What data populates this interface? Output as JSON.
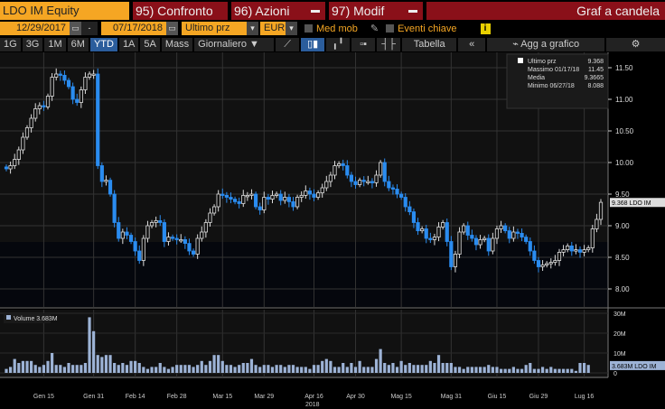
{
  "header": {
    "ticker": "LDO IM Equity",
    "compare": "95) Confronto",
    "actions": "96) Azioni",
    "modify": "97) Modif",
    "chart_type": "Graf a candela"
  },
  "controls": {
    "start_date": "12/29/2017",
    "sep": "-",
    "end_date": "07/17/2018",
    "field": "Ultimo prz",
    "currency": "EUR",
    "moving_avg": "Med mob",
    "key_events": "Eventi chiave",
    "info": "i"
  },
  "toolbar": {
    "periods": [
      "1G",
      "3G",
      "1M",
      "6M",
      "YTD",
      "1A",
      "5A",
      "Mass"
    ],
    "active_period": "YTD",
    "frequency": "Giornaliero ▼",
    "table": "Tabella",
    "collapse": "«",
    "add_to_chart": "Agg a grafico",
    "settings": "⚙"
  },
  "colors": {
    "up": "#dddddd",
    "down": "#2a8cf0",
    "volume": "#9db3d6",
    "accent": "#f5a623",
    "header_red": "#8a1019"
  },
  "chart_data": {
    "type": "candlestick",
    "legend": {
      "last_label": "Ultimo prz",
      "last": "9.368",
      "high_label": "Massimo 01/17/18",
      "high": "11.45",
      "mean_label": "Media",
      "mean": "9.3665",
      "low_label": "Minimo 06/27/18",
      "low": "8.088"
    },
    "price_ticks": [
      "11.50",
      "11.00",
      "10.50",
      "10.00",
      "9.50",
      "9.00",
      "8.50",
      "8.00"
    ],
    "ylim": [
      7.7,
      11.8
    ],
    "last_tag": "9.368 LDO IM",
    "volume_label": "Volume 3.683M",
    "volume_ticks": [
      "30M",
      "20M",
      "10M",
      "0"
    ],
    "volume_tag": "3.683M LDO IM",
    "x_ticks": [
      "Gen 15",
      "Gen 31",
      "Feb 14",
      "Feb 28",
      "Mar 15",
      "Mar 29",
      "Apr 16",
      "Apr 30",
      "Mag 15",
      "Mag 31",
      "Giu 15",
      "Giu 29",
      "Lug 16"
    ],
    "x_tick_index": [
      9,
      21,
      31,
      41,
      52,
      62,
      74,
      84,
      95,
      107,
      118,
      128,
      139
    ],
    "year": "2018",
    "closes": [
      9.9,
      9.95,
      10.05,
      10.2,
      10.4,
      10.55,
      10.7,
      10.85,
      10.9,
      10.88,
      11.05,
      11.35,
      11.4,
      11.38,
      11.3,
      11.2,
      11.0,
      10.95,
      11.15,
      11.35,
      11.4,
      11.4,
      9.95,
      9.7,
      9.72,
      9.5,
      9.05,
      8.8,
      8.9,
      8.85,
      8.75,
      8.6,
      8.45,
      8.8,
      9.0,
      9.05,
      9.08,
      9.05,
      8.75,
      8.82,
      8.8,
      8.78,
      8.78,
      8.72,
      8.6,
      8.55,
      8.8,
      8.9,
      9.05,
      9.2,
      9.3,
      9.5,
      9.48,
      9.45,
      9.42,
      9.38,
      9.35,
      9.48,
      9.48,
      9.5,
      9.3,
      9.25,
      9.45,
      9.42,
      9.48,
      9.5,
      9.4,
      9.45,
      9.38,
      9.3,
      9.45,
      9.48,
      9.55,
      9.5,
      9.45,
      9.52,
      9.6,
      9.7,
      9.8,
      9.95,
      9.98,
      9.95,
      9.8,
      9.7,
      9.65,
      9.72,
      9.7,
      9.7,
      9.68,
      9.8,
      10.0,
      9.7,
      9.6,
      9.58,
      9.5,
      9.45,
      9.3,
      9.22,
      9.05,
      8.92,
      8.95,
      8.8,
      8.78,
      8.82,
      8.98,
      9.05,
      8.75,
      8.35,
      8.55,
      8.9,
      9.0,
      8.85,
      8.8,
      8.7,
      8.78,
      8.8,
      8.6,
      8.8,
      8.95,
      9.0,
      8.92,
      8.8,
      8.9,
      8.88,
      8.82,
      8.75,
      8.6,
      8.45,
      8.35,
      8.38,
      8.4,
      8.42,
      8.45,
      8.58,
      8.62,
      8.68,
      8.6,
      8.62,
      8.58,
      8.62,
      8.65,
      8.95,
      9.1,
      9.37
    ],
    "volumes_m": [
      2,
      3,
      7,
      5,
      6,
      6,
      6,
      4,
      3,
      4,
      6,
      10,
      4,
      4,
      3,
      5,
      4,
      4,
      4,
      5,
      28,
      21,
      9,
      8,
      9,
      9,
      5,
      4,
      5,
      4,
      6,
      6,
      5,
      3,
      2,
      3,
      3,
      5,
      3,
      2,
      3,
      4,
      4,
      4,
      4,
      3,
      4,
      6,
      4,
      6,
      9,
      9,
      6,
      4,
      4,
      3,
      4,
      5,
      5,
      7,
      4,
      3,
      4,
      4,
      3,
      4,
      4,
      3,
      4,
      4,
      3,
      3,
      3,
      2,
      4,
      4,
      6,
      7,
      6,
      3,
      3,
      5,
      3,
      5,
      3,
      6,
      3,
      3,
      3,
      7,
      12,
      5,
      4,
      5,
      3,
      6,
      4,
      5,
      4,
      4,
      4,
      4,
      6,
      5,
      9,
      5,
      5,
      5,
      3,
      3,
      2,
      3,
      3,
      3,
      3,
      3,
      4,
      3,
      3,
      2,
      2,
      2,
      3,
      2,
      2,
      4,
      5,
      2,
      2,
      3,
      2,
      3,
      2,
      2,
      2,
      2,
      2,
      1,
      5,
      5,
      4
    ]
  }
}
